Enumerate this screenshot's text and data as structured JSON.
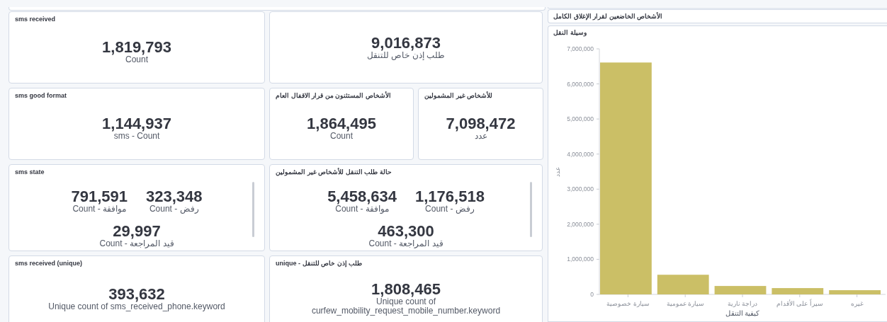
{
  "metric_rows": [
    [
      {
        "metrics": [
          {
            "value": "9,016,873",
            "label": "طلب إذن خاص للتنقل"
          }
        ]
      },
      {
        "title": "sms received",
        "metrics": [
          {
            "value": "1,819,793",
            "label": "Count"
          }
        ]
      }
    ],
    [
      {
        "title": "للأشخاص غير المشمولين",
        "metrics": [
          {
            "value": "7,098,472",
            "label": "عدد"
          }
        ]
      },
      {
        "title": "الأشخاص المستثنون من قرار الاقفال العام",
        "metrics": [
          {
            "value": "1,864,495",
            "label": "Count"
          }
        ]
      },
      {
        "title": "sms good format",
        "metrics": [
          {
            "value": "1,144,937",
            "label": "sms - Count"
          }
        ]
      }
    ],
    [
      {
        "title": "حالة طلب التنقل للأشخاص غير المشمولين",
        "metrics": [
          {
            "value": "1,176,518",
            "label": "Count - رفض"
          },
          {
            "value": "5,458,634",
            "label": "Count - موافقة"
          },
          {
            "value": "463,300",
            "label": "Count - قيد المراجعة"
          }
        ]
      },
      {
        "title": "sms state",
        "metrics": [
          {
            "value": "323,348",
            "label": "Count - رفض"
          },
          {
            "value": "791,591",
            "label": "Count - موافقة"
          },
          {
            "value": "29,997",
            "label": "Count - قيد المراجعة"
          }
        ]
      }
    ],
    [
      {
        "title": "unique - طلب إذن خاص للتنقل",
        "metrics": [
          {
            "value": "1,808,465",
            "label": "Unique count of curfew_mobility_request_mobile_number.keyword"
          }
        ]
      },
      {
        "title": "sms received (unique)",
        "metrics": [
          {
            "value": "393,632",
            "label": "Unique count of sms_received_phone.keyword"
          }
        ]
      }
    ]
  ],
  "chart_panel": {
    "header": "الأشخاص الخاضعين لقرار الإغلاق الكامل",
    "title": "وسيلة النقل",
    "chart_data": {
      "type": "bar",
      "xlabel": "كيفية التنقل",
      "ylabel": "عدد",
      "categories": [
        "سيارة خصوصية",
        "سيارة عمومية",
        "دراجة نارية",
        "سيراً على الأقدام",
        "غيره"
      ],
      "series": [
        {
          "color": "#cbbf66",
          "values": [
            6610000,
            560000,
            240000,
            180000,
            120000
          ]
        }
      ],
      "ylim": [
        0,
        7000000
      ],
      "yticks": [
        {
          "value": 0,
          "label": "0"
        },
        {
          "value": 1000000,
          "label": "1,000,000"
        },
        {
          "value": 2000000,
          "label": "2,000,000"
        },
        {
          "value": 3000000,
          "label": "3,000,000"
        },
        {
          "value": 4000000,
          "label": "4,000,000"
        },
        {
          "value": 5000000,
          "label": "5,000,000"
        },
        {
          "value": 6000000,
          "label": "6,000,000"
        },
        {
          "value": 7000000,
          "label": "7,000,000"
        }
      ]
    }
  }
}
